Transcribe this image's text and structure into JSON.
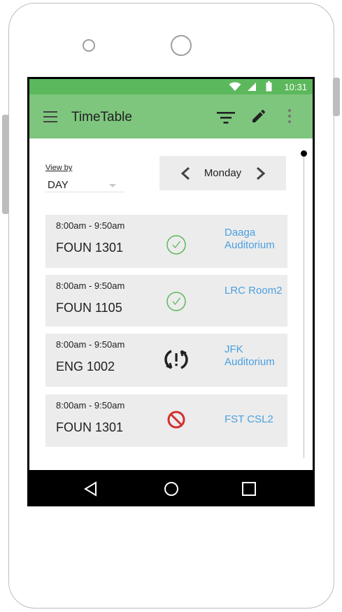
{
  "status_bar": {
    "time": "10:31",
    "icons": [
      "wifi-icon",
      "signal-icon",
      "battery-icon"
    ]
  },
  "app_bar": {
    "title": "TimeTable",
    "actions": [
      "menu-icon",
      "filter-icon",
      "edit-icon",
      "more-vert-icon"
    ]
  },
  "view_by": {
    "label": "View by",
    "value": "DAY"
  },
  "day_selector": {
    "day": "Monday"
  },
  "classes": [
    {
      "time": "8:00am - 9:50am",
      "course": "FOUN 1301",
      "status": "check-icon",
      "room": "Daaga Auditorium"
    },
    {
      "time": "8:00am - 9:50am",
      "course": "FOUN 1105",
      "status": "check-icon",
      "room": "LRC Room2"
    },
    {
      "time": "8:00am - 9:50am",
      "course": "ENG 1002",
      "status": "sync-problem-icon",
      "room": "JFK Auditorium"
    },
    {
      "time": "8:00am - 9:50am",
      "course": "FOUN 1301",
      "status": "blocked-icon",
      "room": "FST CSL2"
    }
  ],
  "nav_bar": {
    "buttons": [
      "back-icon",
      "home-icon",
      "recent-apps-icon"
    ]
  },
  "colors": {
    "status_bar": "#5cb85c",
    "app_bar": "#7ec57e",
    "card_bg": "#ececec",
    "room_link": "#4a9fe0",
    "check": "#5cb85c",
    "blocked": "#d32f2f"
  }
}
